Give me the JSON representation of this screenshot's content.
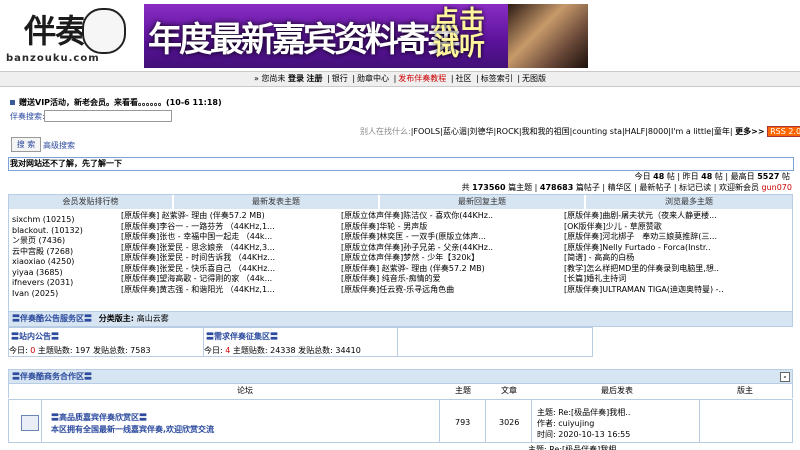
{
  "header": {
    "logo_text": "伴奏酷",
    "logo_url": "banzouku.com",
    "banner_title": "年度最新嘉宾资料寄卖",
    "banner_action_line1": "点击",
    "banner_action_line2": "试听"
  },
  "nav": {
    "guest": "» 您尚未",
    "login": "登录",
    "register": "注册",
    "bank": "银行",
    "medal": "勋章中心",
    "publish": "发布伴奏教程",
    "community": "社区",
    "tags": "标签索引",
    "no_image": "无图版"
  },
  "notice": {
    "text": "赠送VIP活动，新老会员。来看看。。。。。。(10-6 11:18)"
  },
  "search": {
    "label": "伴奏搜索:",
    "button": "搜 索",
    "advanced": "高级搜索"
  },
  "hot_search": {
    "label": "别人在找什么:",
    "terms": "|FOOLS|蓝心湄|刘德华|ROCK|我和我的祖国|counting sta|HALF|8000|I'm a little|童年|",
    "more": "更多>>",
    "rss": "RSS 2.0"
  },
  "welcome_bar": "我对网站还不了解，先了解一下",
  "stats": {
    "line1_today_label": "今日",
    "line1_today": "48",
    "line1_yesterday_label": "帖 | 昨日",
    "line1_yesterday": "48",
    "line1_max_label": "帖 | 最高日",
    "line1_max": "5527",
    "line1_tail": "帖",
    "line2_total_prefix": "共",
    "line2_topics": "173560",
    "line2_topics_label": "篇主题 |",
    "line2_posts": "478683",
    "line2_posts_label": "篇帖子 | 精华区 | 最新帖子 | 标记已读 | 欢迎新会员",
    "line2_new_member": "gun070"
  },
  "grid": {
    "headers": [
      "会员发贴排行榜",
      "最新发表主题",
      "最新回复主题",
      "浏览最多主题"
    ],
    "ranking": [
      "sixchm (10215)",
      "blackout. (10132)",
      "ン景页 (7436)",
      "云中宫殿 (7268)",
      "xiaoxiao (4250)",
      "yiyaa (3685)",
      "ifnevers (2031)",
      "Ivan (2025)"
    ],
    "new_topics": [
      "[原版伴奏] 赵紫骅- 理由 (伴奏57.2 MB)",
      "[原版伴奏]李谷一 - 一路芬芳 （44KHz,1...",
      "[原版伴奏]张也 - 幸福中国一起走 （44k...",
      "[原版伴奏]张爱民 - 思念娘亲 （44KHz,3...",
      "[原版伴奏]张爱民 - 时间告诉我 （44KHz...",
      "[原版伴奏]张爱民 - 快乐喜自己 （44KHz...",
      "[原版伴奏]望海高歌 - 记得刚的家 （44k...",
      "[原版伴奏]黄志强 - 和谐阳光 （44KHz,1..."
    ],
    "new_replies": [
      "[原版立体声伴奏]陈洁仪 - 喜欢你(44KHz..",
      "[原版伴奏]华轮 - 男声版",
      "[原版伴奏]林奕匡 - 一双手(原版立体声...",
      "[原版立体声伴奏]孙子兄弟 - 父亲(44KHz..",
      "[原版立体声伴奏]梦然 - 少年【320k】",
      "[原版伴奏] 赵紫骅- 理由 (伴奏57.2 MB)",
      "[原版伴奏] 纯音乐-痴情的爱",
      "[原版伴奏]任云霓-乐寻远角色曲"
    ],
    "most_viewed": [
      "[原版伴奏]曲剧-屠夫状元（夜来人静更楼...",
      "[OK版伴奏]少儿 - 草原赞歌",
      "[原版伴奏]河北梆子　奉劝三娘莫推辞(三...",
      "[原版伴奏]Nelly Furtado - Forca(Instr..",
      "[简谱] - 高高的白杨",
      "[教学]怎么样把MD里的伴奏录到电脑里,想..",
      "[长篇]婚礼主持词",
      "[原版伴奏]ULTRAMAN TIGA(迪迦奥特曼) -.."
    ]
  },
  "section1": {
    "title": "〓伴奏酷公告服务区〓",
    "moderator_label": "分类版主:",
    "moderator": "高山云雾",
    "boards": [
      {
        "name": "〓站内公告〓",
        "today_label": "今日:",
        "today": "0",
        "stats": "主题贴数: 197 发贴总数: 7583"
      },
      {
        "name": "〓需求伴奏征集区〓",
        "today_label": "今日:",
        "today": "4",
        "stats": "主题贴数: 24338 发贴总数: 34410"
      }
    ]
  },
  "section2": {
    "title": "〓伴奏酷商务合作区〓",
    "collapse": "-",
    "headers": {
      "forum": "论坛",
      "topics": "主题",
      "posts": "文章",
      "last": "最后发表",
      "mod": "版主"
    },
    "row": {
      "name": "〓高品质嘉宾伴奏欣赏区〓",
      "desc": "本区拥有全国最新一线嘉宾伴奏,欢迎欣赏交流",
      "topics": "793",
      "posts": "3026",
      "last_topic": "主题: Re:[极品伴奏]我相..",
      "last_author": "作者: cuiyujing",
      "last_time": "时间: 2020-10-13 16:55",
      "next_partial": "主题: Re:[极品伴奏]我相"
    }
  }
}
